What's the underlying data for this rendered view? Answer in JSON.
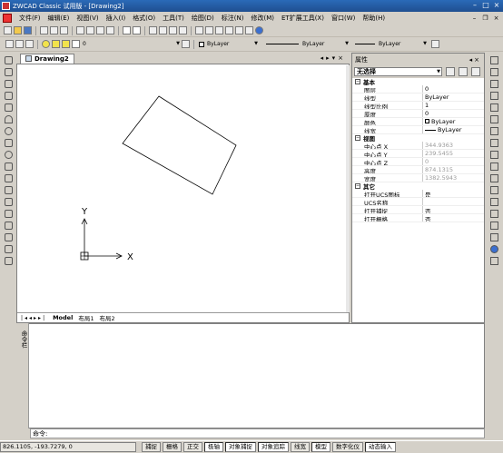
{
  "title_bar": {
    "text": "ZWCAD Classic 试用版 - [Drawing2]"
  },
  "menu": {
    "items": [
      "文件(F)",
      "编辑(E)",
      "视图(V)",
      "插入(I)",
      "格式(O)",
      "工具(T)",
      "绘图(D)",
      "标注(N)",
      "修改(M)",
      "ET扩展工具(X)",
      "窗口(W)",
      "帮助(H)"
    ]
  },
  "layer_combo": {
    "value": "0"
  },
  "color_combo": {
    "value": "ByLayer"
  },
  "linetype_combo": {
    "value": "ByLayer"
  },
  "lineweight_combo": {
    "value": "ByLayer"
  },
  "drawing_tab": {
    "label": "Drawing2"
  },
  "layout_tabs": {
    "model": "Model",
    "layout1": "布局1",
    "layout2": "布局2"
  },
  "ucs": {
    "x_label": "X",
    "y_label": "Y"
  },
  "properties": {
    "header": "属性",
    "selection": "无选择",
    "groups": [
      {
        "name": "基本",
        "rows": [
          {
            "k": "图层",
            "v": "0"
          },
          {
            "k": "线型",
            "v": "ByLayer"
          },
          {
            "k": "线型比例",
            "v": "1"
          },
          {
            "k": "厚度",
            "v": "0"
          },
          {
            "k": "颜色",
            "v": "ByLayer"
          },
          {
            "k": "线宽",
            "v": "ByLayer"
          }
        ]
      },
      {
        "name": "视图",
        "rows": [
          {
            "k": "中心点 X",
            "v": "344.9363",
            "gray": true
          },
          {
            "k": "中心点 Y",
            "v": "239.5455",
            "gray": true
          },
          {
            "k": "中心点 Z",
            "v": "0",
            "gray": true
          },
          {
            "k": "高度",
            "v": "874.1315",
            "gray": true
          },
          {
            "k": "宽度",
            "v": "1382.5943",
            "gray": true
          }
        ]
      },
      {
        "name": "其它",
        "rows": [
          {
            "k": "打开UCS图标",
            "v": "是"
          },
          {
            "k": "UCS名称",
            "v": ""
          },
          {
            "k": "打开捕捉",
            "v": "否"
          },
          {
            "k": "打开栅格",
            "v": "否"
          }
        ]
      }
    ]
  },
  "command": {
    "side_label": "命令栏",
    "prompt": "命令:"
  },
  "status": {
    "coords": "826.1105,  -193.7279,  0",
    "buttons": [
      "捕捉",
      "栅格",
      "正交",
      "极轴",
      "对象捕捉",
      "对象追踪",
      "线宽",
      "模型",
      "数字化仪",
      "动态输入"
    ]
  }
}
